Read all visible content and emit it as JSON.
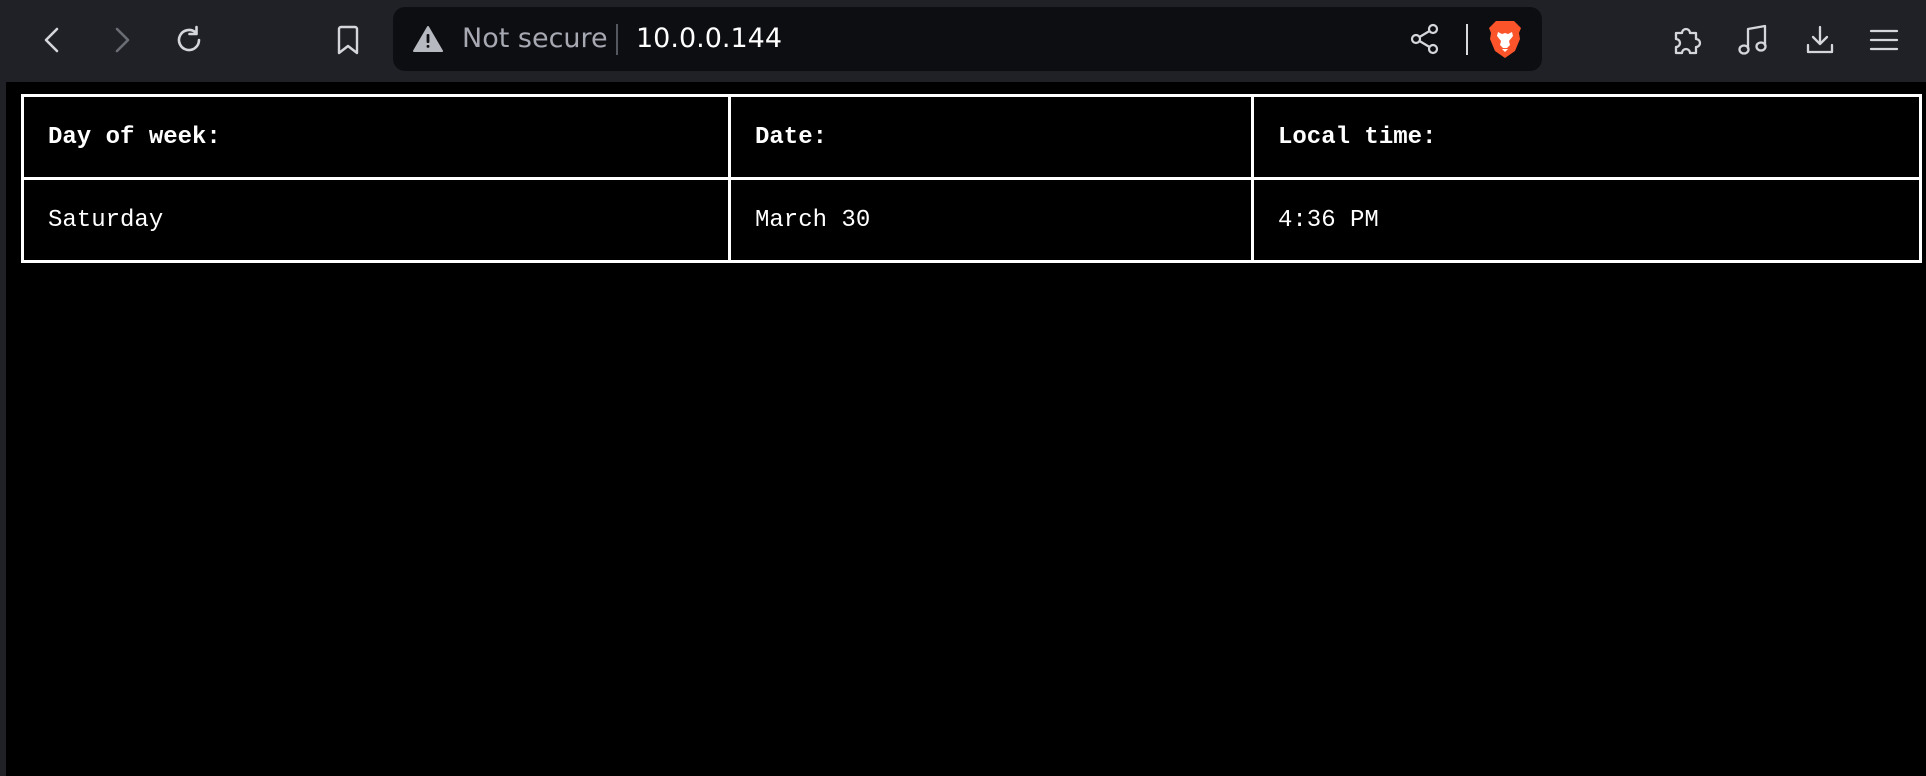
{
  "browser": {
    "security_label": "Not secure",
    "address": "10.0.0.144",
    "icons": {
      "back": "chevron-left-icon",
      "forward": "chevron-right-icon",
      "reload": "reload-icon",
      "bookmark": "bookmark-icon",
      "warning": "warning-triangle-icon",
      "share": "share-icon",
      "shields": "brave-lion-icon",
      "extensions": "puzzle-icon",
      "media": "music-note-icon",
      "downloads": "download-icon",
      "menu": "hamburger-menu-icon"
    },
    "colors": {
      "toolbar": "#202127",
      "urlbar": "#0d0e12",
      "brand": "#fb542b"
    }
  },
  "table": {
    "headers": [
      "Day of week:",
      "Date:",
      "Local time:"
    ],
    "rows": [
      [
        "Saturday",
        "March 30",
        "4:36 PM"
      ]
    ]
  }
}
